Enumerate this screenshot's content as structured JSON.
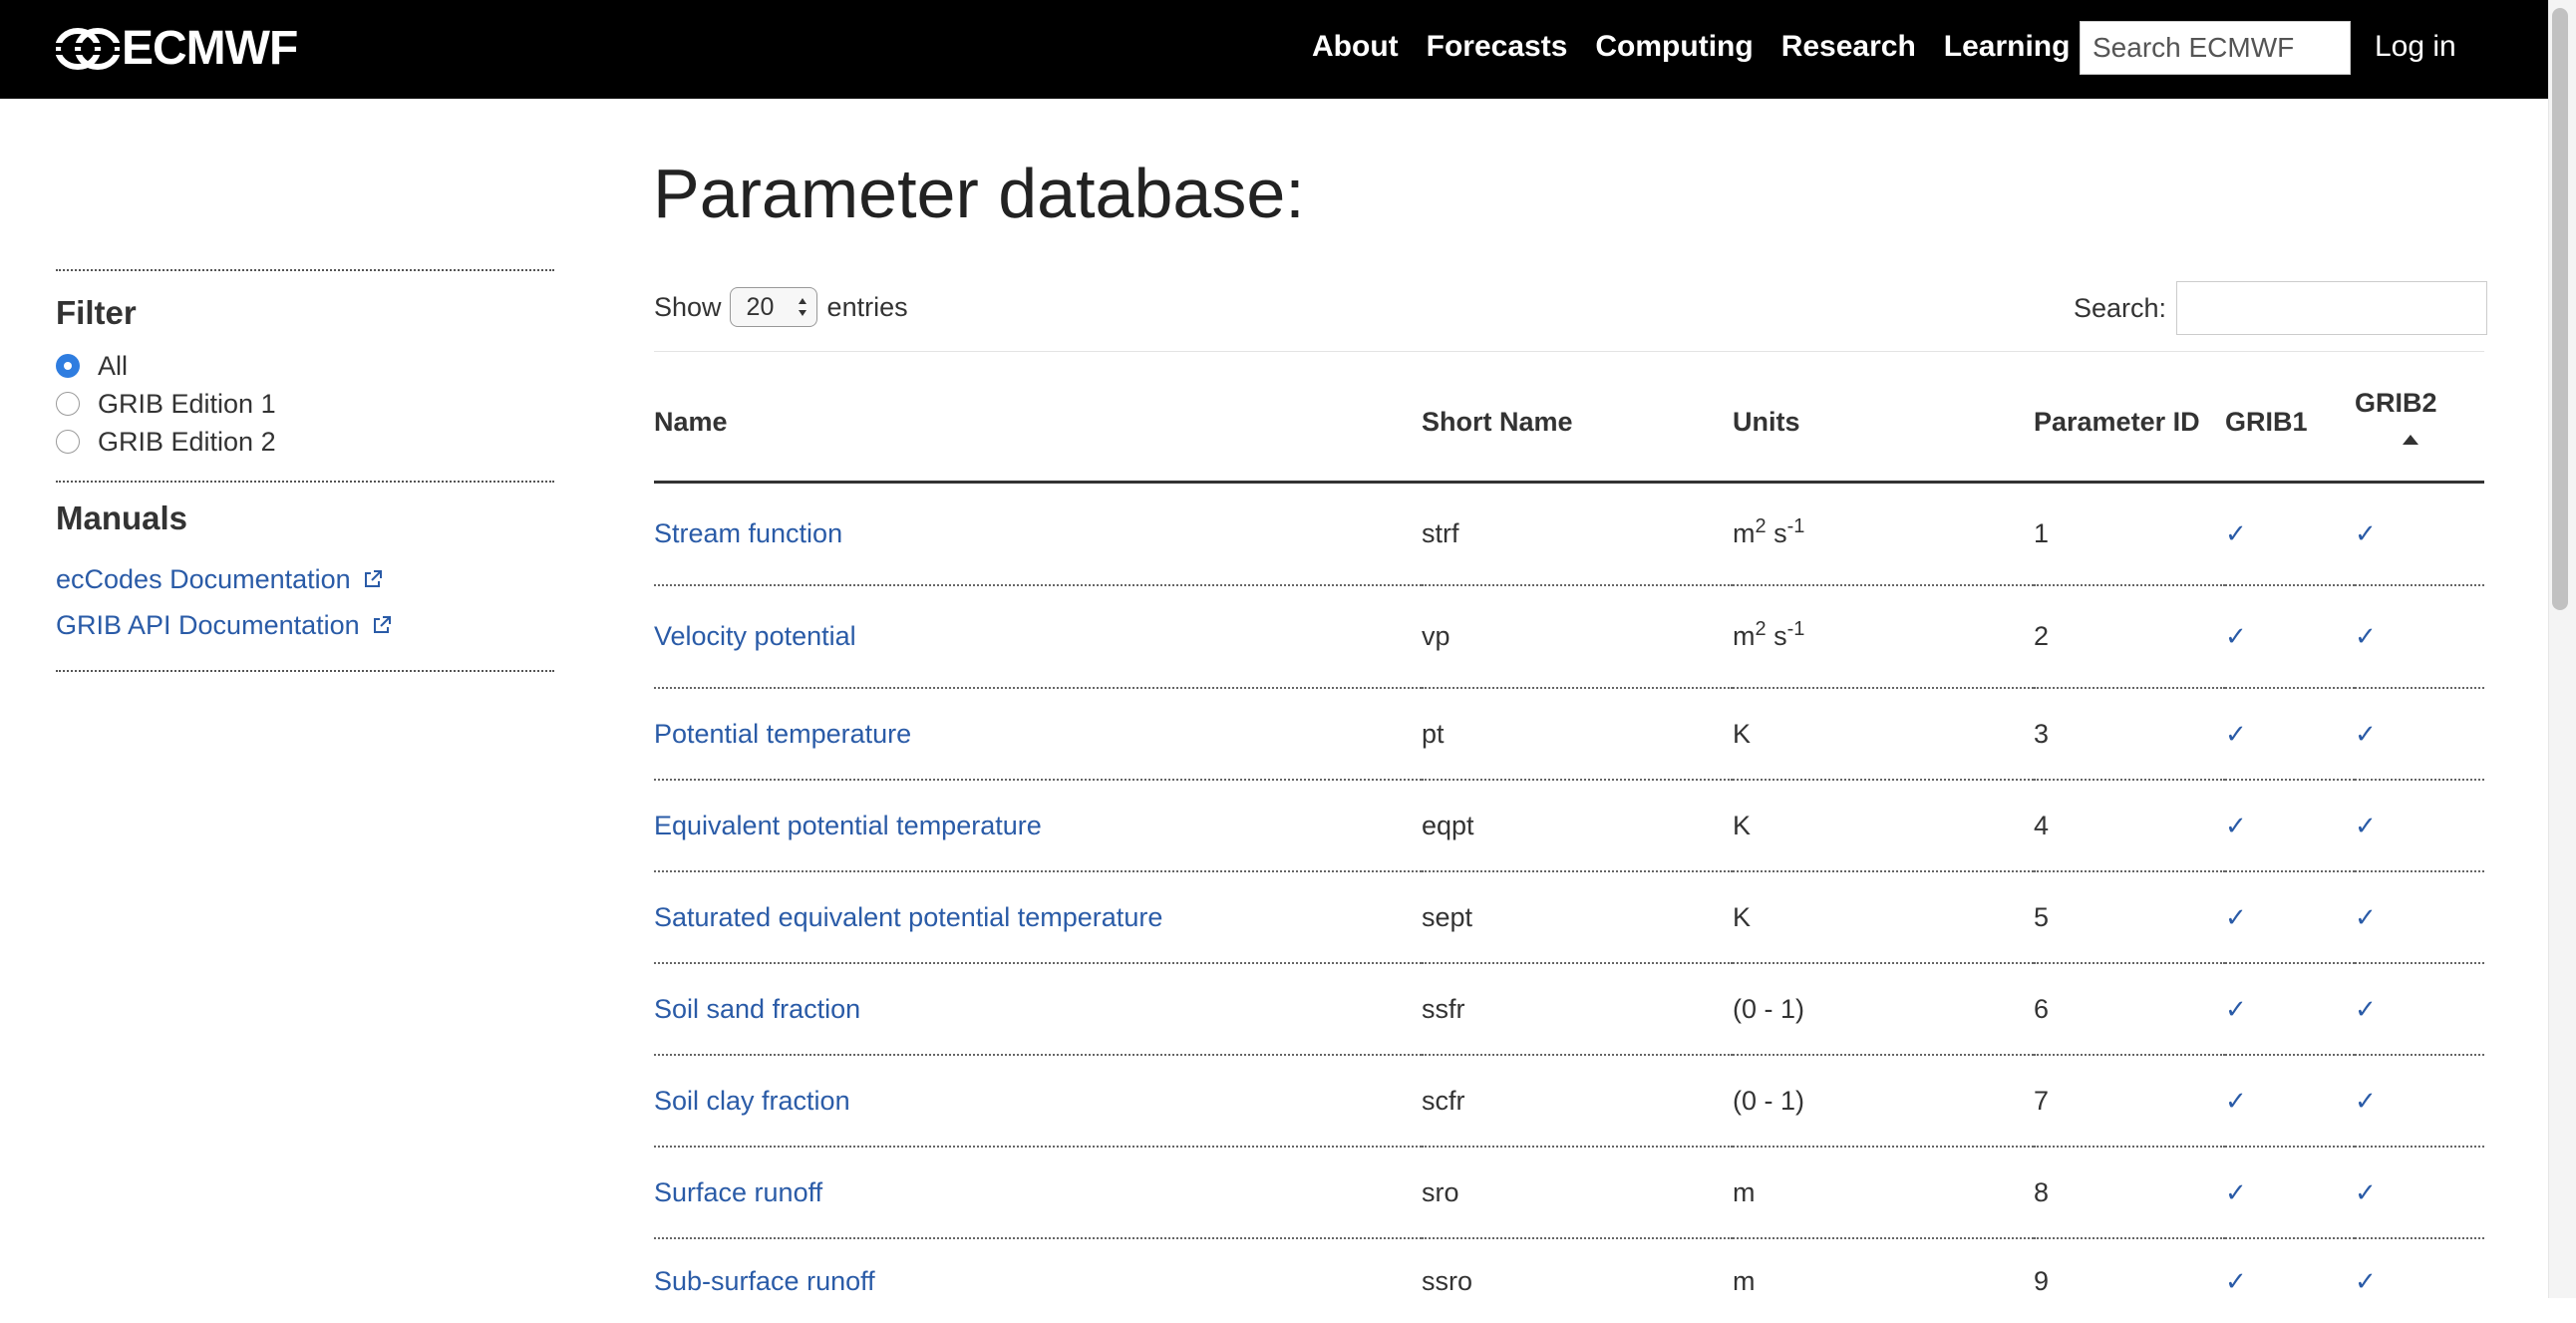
{
  "brand": {
    "name": "ECMWF"
  },
  "nav": {
    "items": [
      "About",
      "Forecasts",
      "Computing",
      "Research",
      "Learning"
    ],
    "search_placeholder": "Search ECMWF",
    "login_label": "Log in"
  },
  "sidebar": {
    "filter_heading": "Filter",
    "filter_options": [
      {
        "label": "All",
        "selected": true
      },
      {
        "label": "GRIB Edition 1",
        "selected": false
      },
      {
        "label": "GRIB Edition 2",
        "selected": false
      }
    ],
    "manuals_heading": "Manuals",
    "manual_links": [
      {
        "label": "ecCodes Documentation",
        "icon": "external-link-icon"
      },
      {
        "label": "GRIB API Documentation",
        "icon": "external-link-icon"
      }
    ]
  },
  "main": {
    "title": "Parameter database:",
    "length_label_pre": "Show",
    "length_value": "20",
    "length_label_post": "entries",
    "search_label": "Search:"
  },
  "table": {
    "columns": {
      "name": "Name",
      "short_name": "Short Name",
      "units": "Units",
      "param_id": "Parameter ID",
      "grib1": "GRIB1",
      "grib2": "GRIB2"
    },
    "sorted_column": "grib2",
    "sort_direction": "ascending",
    "rows": [
      {
        "name": "Stream function",
        "short_name": "strf",
        "units_base1": "m",
        "units_exp1": "2",
        "units_base2": " s",
        "units_exp2": "-1",
        "param_id": "1",
        "grib1": true,
        "grib2": true
      },
      {
        "name": "Velocity potential",
        "short_name": "vp",
        "units_base1": "m",
        "units_exp1": "2",
        "units_base2": " s",
        "units_exp2": "-1",
        "param_id": "2",
        "grib1": true,
        "grib2": true
      },
      {
        "name": "Potential temperature",
        "short_name": "pt",
        "units": "K",
        "param_id": "3",
        "grib1": true,
        "grib2": true
      },
      {
        "name": "Equivalent potential temperature",
        "short_name": "eqpt",
        "units": "K",
        "param_id": "4",
        "grib1": true,
        "grib2": true
      },
      {
        "name": "Saturated equivalent potential temperature",
        "short_name": "sept",
        "units": "K",
        "param_id": "5",
        "grib1": true,
        "grib2": true
      },
      {
        "name": "Soil sand fraction",
        "short_name": "ssfr",
        "units": "(0 - 1)",
        "param_id": "6",
        "grib1": true,
        "grib2": true
      },
      {
        "name": "Soil clay fraction",
        "short_name": "scfr",
        "units": "(0 - 1)",
        "param_id": "7",
        "grib1": true,
        "grib2": true
      },
      {
        "name": "Surface runoff",
        "short_name": "sro",
        "units": "m",
        "param_id": "8",
        "grib1": true,
        "grib2": true
      },
      {
        "name": "Sub-surface runoff",
        "short_name": "ssro",
        "units": "m",
        "param_id": "9",
        "grib1": true,
        "grib2": true
      }
    ],
    "check_glyph": "✓"
  },
  "colors": {
    "topbar": "#000000",
    "link": "#2a5ba7",
    "radio_selected": "#2f7de0"
  }
}
